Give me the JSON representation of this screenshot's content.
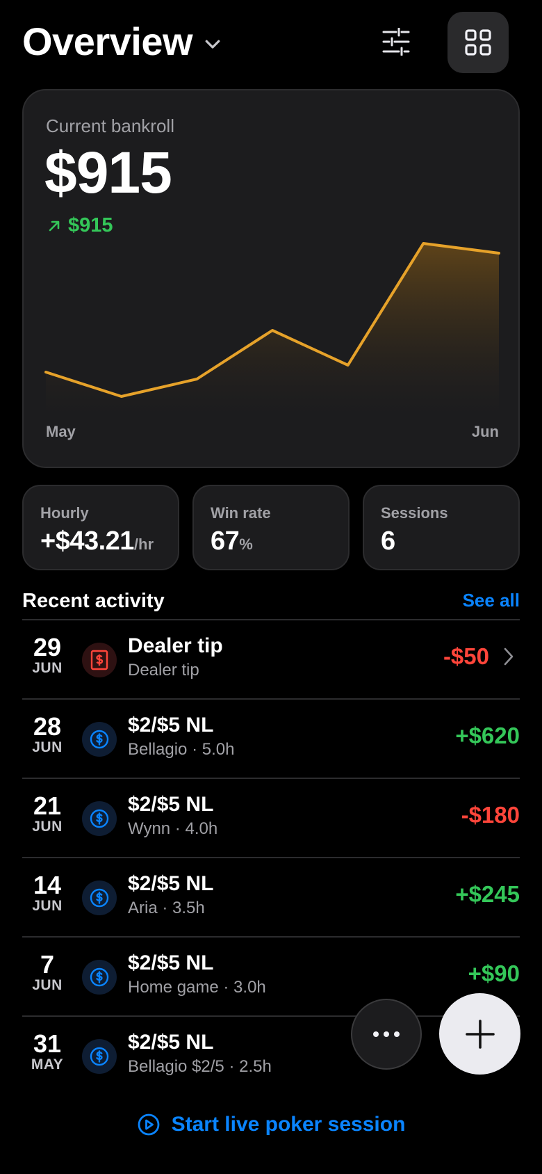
{
  "header": {
    "title": "Overview",
    "icons": {
      "dropdown": "chevron-down-icon",
      "filter": "sliders-icon",
      "grid": "grid-icon"
    }
  },
  "bankroll": {
    "label": "Current bankroll",
    "value": "$915",
    "change": "$915",
    "change_icon": "arrow-up-right-icon"
  },
  "chart_data": {
    "type": "area",
    "x": [
      "May",
      "",
      "",
      "",
      "",
      "",
      "Jun"
    ],
    "series": [
      {
        "values": [
          -35,
          -70,
          -45,
          25,
          -25,
          150,
          136
        ]
      }
    ],
    "xlabel": "",
    "ylabel": "",
    "tick_labels": {
      "start": "May",
      "end": "Jun"
    },
    "ylim": [
      -100,
      160
    ],
    "grid": false,
    "line_color": "#e6a22a",
    "fill_color": "#5a4018"
  },
  "stats": [
    {
      "label": "Hourly",
      "value": "+$43.21",
      "unit": "/hr"
    },
    {
      "label": "Win rate",
      "value": "67",
      "unit": "%"
    },
    {
      "label": "Sessions",
      "value": "6",
      "unit": ""
    }
  ],
  "activity": {
    "title": "Recent activity",
    "see_all": "See all",
    "rows": [
      {
        "day": "29",
        "month": "JUN",
        "title": "Dealer tip",
        "subtitle": "Dealer tip",
        "amount": "-$50",
        "kind": "tip",
        "sign": "neg"
      },
      {
        "day": "28",
        "month": "JUN",
        "title": "$2/$5 NL",
        "subtitle": "Bellagio · 5.0h",
        "amount": "+$620",
        "kind": "session",
        "sign": "pos"
      },
      {
        "day": "21",
        "month": "JUN",
        "title": "$2/$5 NL",
        "subtitle": "Wynn · 4.0h",
        "amount": "-$180",
        "kind": "session",
        "sign": "neg"
      },
      {
        "day": "14",
        "month": "JUN",
        "title": "$2/$5 NL",
        "subtitle": "Aria · 3.5h",
        "amount": "+$245",
        "kind": "session",
        "sign": "pos"
      },
      {
        "day": "7",
        "month": "JUN",
        "title": "$2/$5 NL",
        "subtitle": "Home game · 3.0h",
        "amount": "+$90",
        "kind": "session",
        "sign": "pos"
      },
      {
        "day": "31",
        "month": "MAY",
        "title": "$2/$5 NL",
        "subtitle": "Bellagio $2/5 · 2.5h",
        "amount": "",
        "kind": "session",
        "sign": "neg"
      }
    ]
  },
  "fab": {
    "more_icon": "more-horizontal-icon",
    "add_icon": "plus-icon"
  },
  "start_session": {
    "label": "Start live poker session",
    "icon": "play-circle-icon"
  },
  "colors": {
    "positive": "#34c759",
    "negative": "#ff453a",
    "accent": "#0a84ff",
    "card": "#1c1c1e",
    "chart_line": "#e6a22a"
  }
}
